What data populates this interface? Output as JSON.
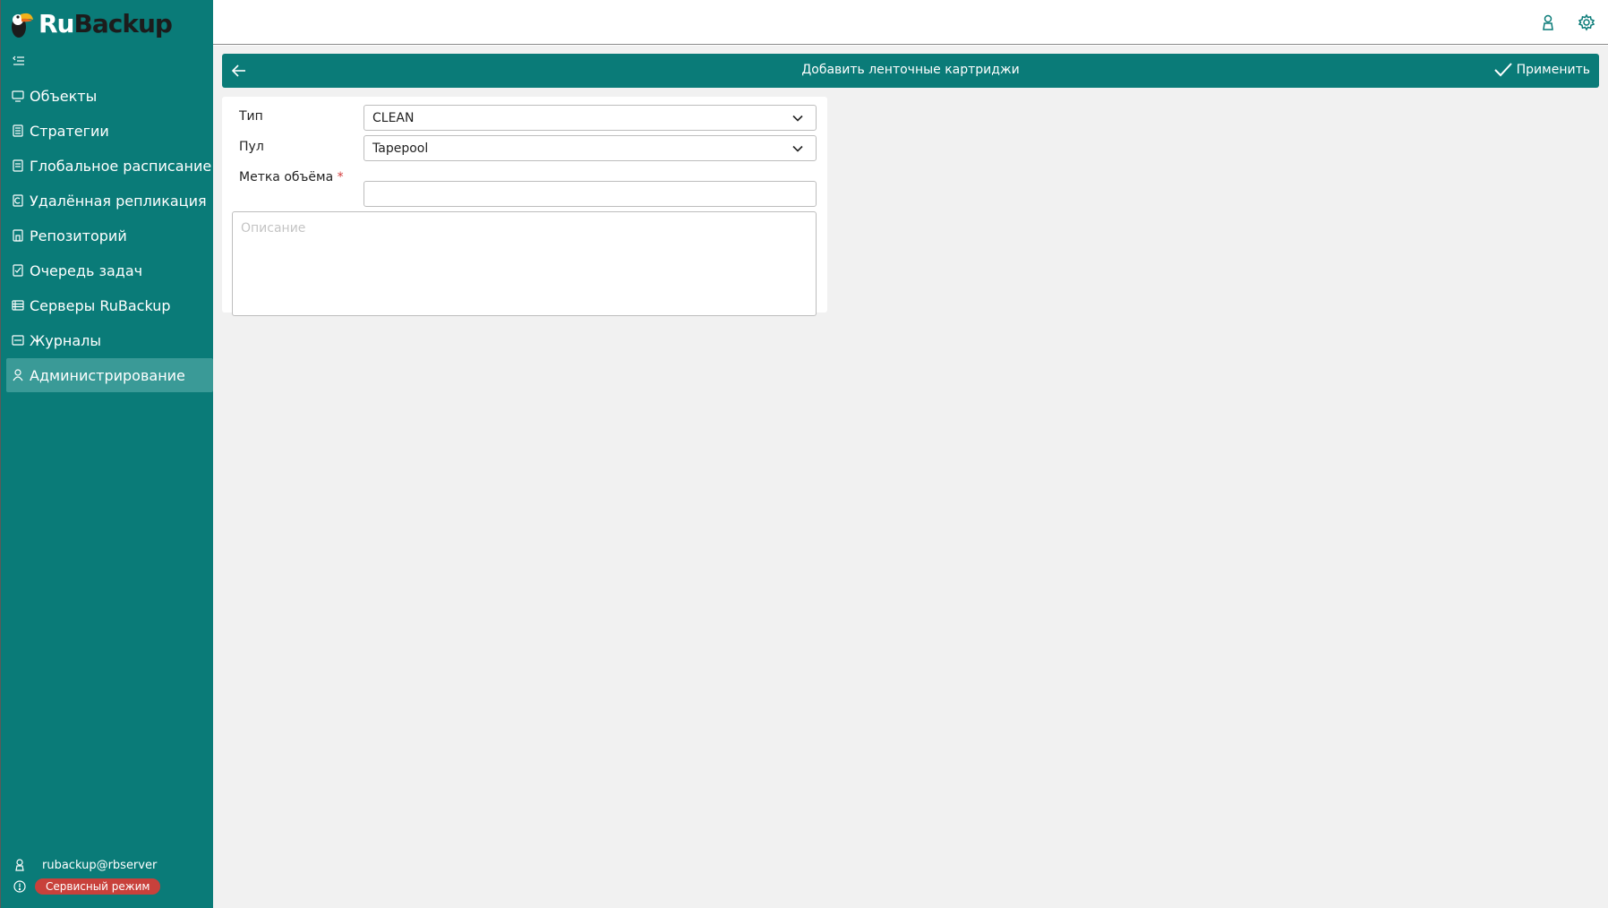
{
  "app": {
    "logo_ru": "Ru",
    "logo_backup": "Backup"
  },
  "sidebar": {
    "items": [
      {
        "label": "Объекты",
        "icon": "monitor-icon"
      },
      {
        "label": "Стратегии",
        "icon": "document-icon"
      },
      {
        "label": "Глобальное расписание",
        "icon": "schedule-icon"
      },
      {
        "label": "Удалённая репликация",
        "icon": "replication-icon"
      },
      {
        "label": "Репозиторий",
        "icon": "repository-icon"
      },
      {
        "label": "Очередь задач",
        "icon": "clipboard-check-icon"
      },
      {
        "label": "Серверы RuBackup",
        "icon": "server-icon"
      },
      {
        "label": "Журналы",
        "icon": "log-icon"
      },
      {
        "label": "Администрирование",
        "icon": "admin-user-icon",
        "active": true
      }
    ],
    "user": "rubackup@rbserver",
    "mode_badge": "Сервисный режим"
  },
  "header": {
    "title": "Добавить ленточные картриджи",
    "apply_label": "Применить"
  },
  "form": {
    "type_label": "Тип",
    "type_value": "CLEAN",
    "pool_label": "Пул",
    "pool_value": "Tapepool",
    "volume_label": "Метка объёма",
    "volume_required": "*",
    "volume_value": "",
    "description_placeholder": "Описание"
  },
  "colors": {
    "primary": "#0a7b78",
    "active_item": "#3a9a97",
    "badge": "#c8413b",
    "background": "#f1f1f1"
  }
}
